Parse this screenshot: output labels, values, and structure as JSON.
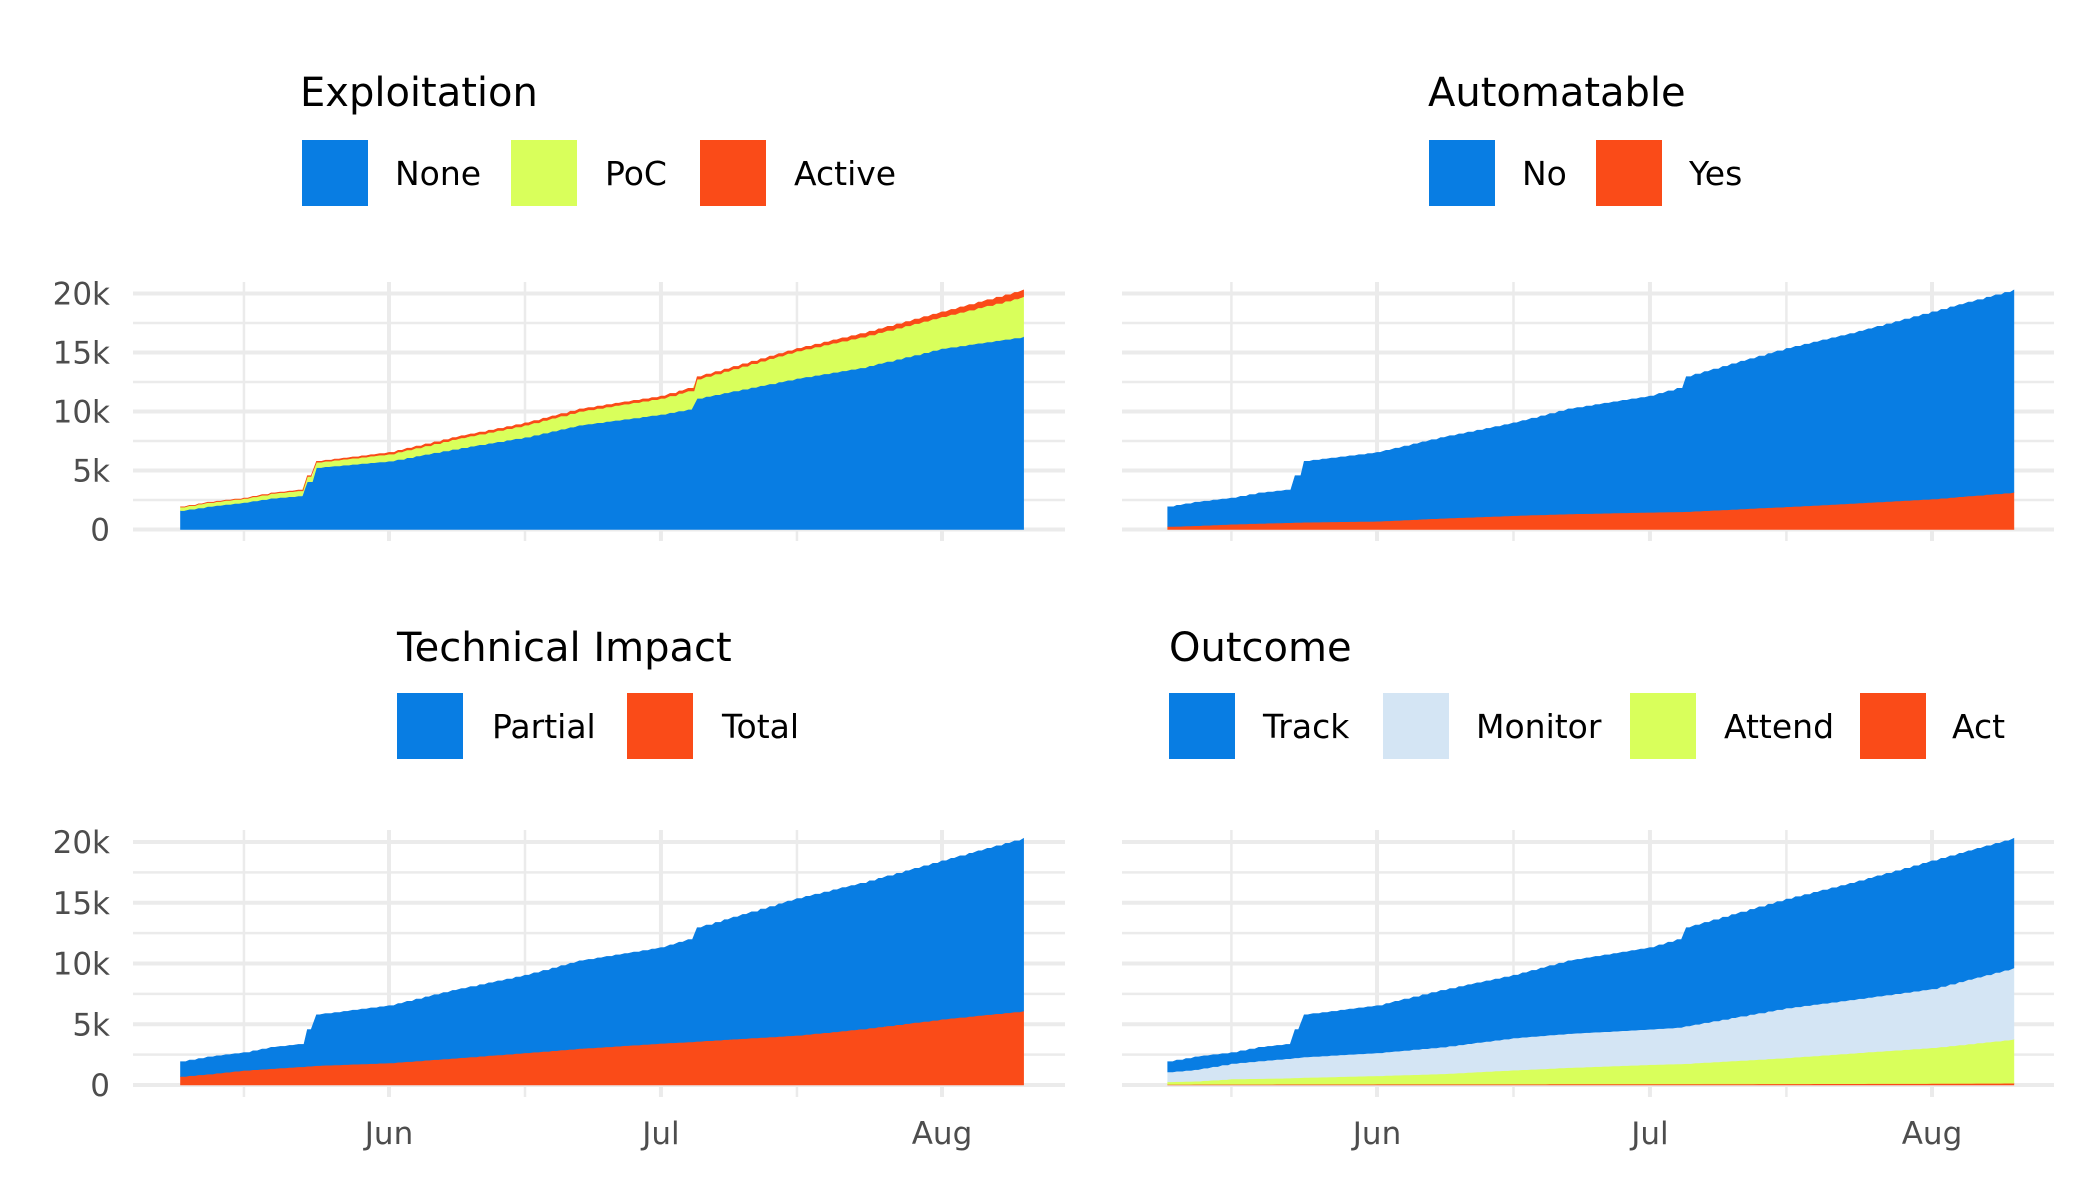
{
  "figure": {
    "background": "#ffffff",
    "colors": {
      "blue": "#087de3",
      "lime": "#d9ff5b",
      "orange": "#fa4b18",
      "light_blue": "#d4e5f4",
      "grid": "#ebebeb",
      "tick_text": "#4d4d4d"
    }
  },
  "chart_data": [
    {
      "id": "exploitation",
      "type": "area",
      "stacked": true,
      "title": "Exploitation",
      "legend": [
        "None",
        "PoC",
        "Active"
      ],
      "legend_placement": "top",
      "stack_order_bottom_to_top": [
        "None",
        "PoC",
        "Active"
      ],
      "x": [
        "May 9",
        "May 12",
        "May 16",
        "May 19",
        "May 22",
        "May 24",
        "Jun 1",
        "Jun 8",
        "Jun 16",
        "Jun 22",
        "Jul 1",
        "Jul 4",
        "Jul 5",
        "Jul 16",
        "Jul 23",
        "Aug 1",
        "Aug 10"
      ],
      "series": [
        {
          "name": "None",
          "color": "#087de3",
          "values": [
            1600,
            1950,
            2300,
            2650,
            2850,
            5250,
            5800,
            6800,
            7830,
            8850,
            9760,
            10190,
            11120,
            12810,
            13700,
            15350,
            16340
          ]
        },
        {
          "name": "PoC",
          "color": "#d9ff5b",
          "values": [
            300,
            330,
            330,
            400,
            430,
            450,
            590,
            820,
            1020,
            1170,
            1360,
            1550,
            1630,
            2320,
            2600,
            2680,
            3390
          ]
        },
        {
          "name": "Active",
          "color": "#fa4b18",
          "values": [
            20,
            30,
            40,
            50,
            60,
            80,
            140,
            170,
            190,
            200,
            190,
            230,
            200,
            220,
            300,
            420,
            570
          ]
        }
      ],
      "xlabel": "",
      "ylabel": "",
      "ylim": [
        0,
        20000
      ],
      "yticks": [
        "0",
        "5k",
        "10k",
        "15k",
        "20k"
      ],
      "xticks": [
        "Jun",
        "Jul",
        "Aug"
      ],
      "show_xtick_labels": false,
      "grid": true
    },
    {
      "id": "automatable",
      "type": "area",
      "stacked": true,
      "title": "Automatable",
      "legend": [
        "No",
        "Yes"
      ],
      "legend_placement": "top",
      "stack_order_bottom_to_top": [
        "Yes",
        "No"
      ],
      "x": [
        "May 9",
        "May 12",
        "May 16",
        "May 19",
        "May 22",
        "May 24",
        "Jun 1",
        "Jun 8",
        "Jun 16",
        "Jun 22",
        "Jul 1",
        "Jul 4",
        "Jul 5",
        "Jul 16",
        "Jul 23",
        "Aug 1",
        "Aug 10"
      ],
      "series": [
        {
          "name": "No",
          "color": "#087de3",
          "values": [
            1670,
            1990,
            2220,
            2580,
            2760,
            5160,
            5830,
            6840,
            7860,
            8900,
            9850,
            10470,
            11430,
            13420,
            14400,
            15860,
            17150
          ]
        },
        {
          "name": "Yes",
          "color": "#fa4b18",
          "values": [
            250,
            320,
            450,
            520,
            580,
            620,
            700,
            950,
            1180,
            1320,
            1460,
            1500,
            1520,
            1930,
            2200,
            2590,
            3150
          ]
        }
      ],
      "xlabel": "",
      "ylabel": "",
      "ylim": [
        0,
        20000
      ],
      "yticks": [
        "0",
        "5k",
        "10k",
        "15k",
        "20k"
      ],
      "show_ytick_labels": false,
      "xticks": [
        "Jun",
        "Jul",
        "Aug"
      ],
      "show_xtick_labels": false,
      "grid": true
    },
    {
      "id": "technical-impact",
      "type": "area",
      "stacked": true,
      "title": "Technical Impact",
      "legend": [
        "Partial",
        "Total"
      ],
      "legend_placement": "top",
      "stack_order_bottom_to_top": [
        "Total",
        "Partial"
      ],
      "x": [
        "May 9",
        "May 12",
        "May 16",
        "May 19",
        "May 22",
        "May 24",
        "Jun 1",
        "Jun 8",
        "Jun 16",
        "Jun 22",
        "Jul 1",
        "Jul 4",
        "Jul 5",
        "Jul 16",
        "Jul 23",
        "Aug 1",
        "Aug 10"
      ],
      "series": [
        {
          "name": "Partial",
          "color": "#087de3",
          "values": [
            1210,
            1410,
            1460,
            1750,
            1840,
            4180,
            4710,
            5590,
            6390,
            7220,
            7880,
            8420,
            9350,
            11260,
            12000,
            13030,
            14210
          ]
        },
        {
          "name": "Total",
          "color": "#fa4b18",
          "values": [
            710,
            900,
            1210,
            1350,
            1500,
            1600,
            1820,
            2200,
            2650,
            3000,
            3430,
            3550,
            3600,
            4090,
            4600,
            5420,
            6090
          ]
        }
      ],
      "xlabel": "",
      "ylabel": "",
      "ylim": [
        0,
        20000
      ],
      "yticks": [
        "0",
        "5k",
        "10k",
        "15k",
        "20k"
      ],
      "xticks": [
        "Jun",
        "Jul",
        "Aug"
      ],
      "grid": true
    },
    {
      "id": "outcome",
      "type": "area",
      "stacked": true,
      "title": "Outcome",
      "legend": [
        "Track",
        "Monitor",
        "Attend",
        "Act"
      ],
      "legend_placement": "top",
      "stack_order_bottom_to_top": [
        "Act",
        "Attend",
        "Monitor",
        "Track"
      ],
      "x": [
        "May 9",
        "May 12",
        "May 16",
        "May 19",
        "May 22",
        "May 24",
        "Jun 1",
        "Jun 8",
        "Jun 16",
        "Jun 22",
        "Jul 1",
        "Jul 4",
        "Jul 5",
        "Jul 16",
        "Jul 23",
        "Aug 1",
        "Aug 10"
      ],
      "series": [
        {
          "name": "Track",
          "color": "#087de3",
          "values": [
            850,
            1045,
            900,
            1120,
            1175,
            3465,
            3880,
            4670,
            5165,
            5990,
            6720,
            7235,
            8085,
            8970,
            9590,
            10530,
            10660
          ]
        },
        {
          "name": "Monitor",
          "color": "#d4e5f4",
          "values": [
            810,
            950,
            1280,
            1450,
            1600,
            1700,
            1890,
            2200,
            2650,
            2800,
            2910,
            3000,
            3100,
            4100,
            4400,
            4850,
            5880
          ]
        },
        {
          "name": "Attend",
          "color": "#d9ff5b",
          "values": [
            210,
            260,
            430,
            470,
            500,
            550,
            690,
            850,
            1150,
            1350,
            1600,
            1650,
            1680,
            2140,
            2500,
            2950,
            3610
          ]
        },
        {
          "name": "Act",
          "color": "#fa4b18",
          "values": [
            50,
            55,
            60,
            60,
            65,
            65,
            70,
            70,
            75,
            80,
            80,
            85,
            85,
            100,
            110,
            120,
            150
          ]
        }
      ],
      "xlabel": "",
      "ylabel": "",
      "ylim": [
        0,
        20000
      ],
      "yticks": [
        "0",
        "5k",
        "10k",
        "15k",
        "20k"
      ],
      "show_ytick_labels": false,
      "xticks": [
        "Jun",
        "Jul",
        "Aug"
      ],
      "grid": true
    }
  ]
}
